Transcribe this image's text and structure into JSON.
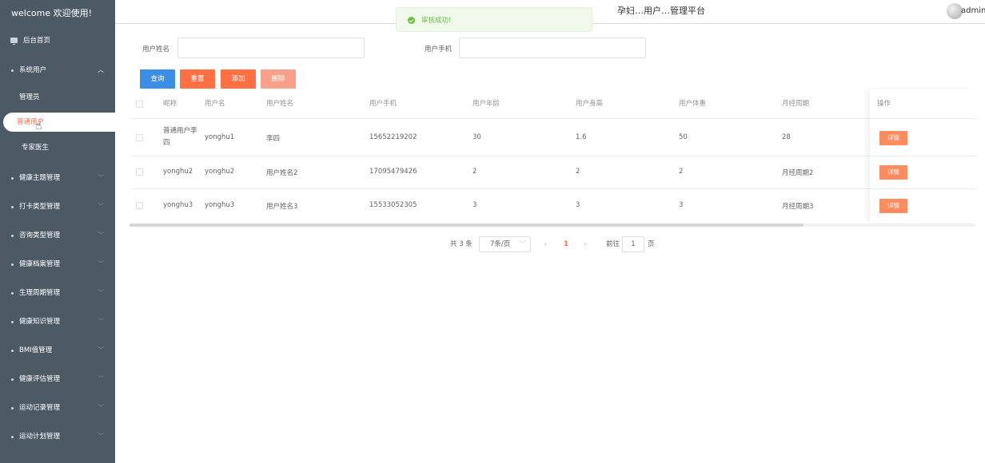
{
  "sidebar": {
    "brand": "welcome 欢迎使用!",
    "home": "后台首页",
    "system_users": "系统用户",
    "sub_items": [
      "管理员",
      "普通用户",
      "专家医生"
    ],
    "menus": [
      "健康主题管理",
      "打卡类型管理",
      "咨询类型管理",
      "健康档案管理",
      "生理周期管理",
      "健康知识管理",
      "BMI值管理",
      "健康评估管理",
      "运动记录管理",
      "运动计划管理"
    ],
    "colors": {
      "bg": "#4c5a66",
      "active_text": "#ff6d4a"
    }
  },
  "header": {
    "title": "孕妇…用户…管理平台",
    "username": "admin",
    "dropdown_icon": "caret-down-icon"
  },
  "toast": {
    "message": "审核成功!",
    "icon": "check-circle-icon",
    "color": "#67c23a"
  },
  "search": {
    "name_label": "用户姓名",
    "phone_label": "用户手机",
    "name_value": "",
    "phone_value": ""
  },
  "buttons": {
    "query": "查询",
    "reset": "重置",
    "add": "添加",
    "delete": "删除"
  },
  "table": {
    "headers": [
      "昵称",
      "用户名",
      "用户姓名",
      "用户手机",
      "用户年龄",
      "用户身高",
      "用户体重",
      "月经周期",
      "操作"
    ],
    "rows": [
      [
        "普通用户李四",
        "yonghu1",
        "李四",
        "15652219202",
        "30",
        "1.6",
        "50",
        "28"
      ],
      [
        "yonghu2",
        "yonghu2",
        "用户姓名2",
        "17095479426",
        "2",
        "2",
        "2",
        "月经周期2"
      ],
      [
        "yonghu3",
        "yonghu3",
        "用户姓名3",
        "15533052305",
        "3",
        "3",
        "3",
        "月经周期3"
      ]
    ],
    "detail_label": "详情"
  },
  "pagination": {
    "total": "共 3 条",
    "page_size": "7条/页",
    "prev": "‹",
    "current": "1",
    "next": "›",
    "goto_label": "前往",
    "goto_value": "1",
    "page_suffix": "页"
  }
}
